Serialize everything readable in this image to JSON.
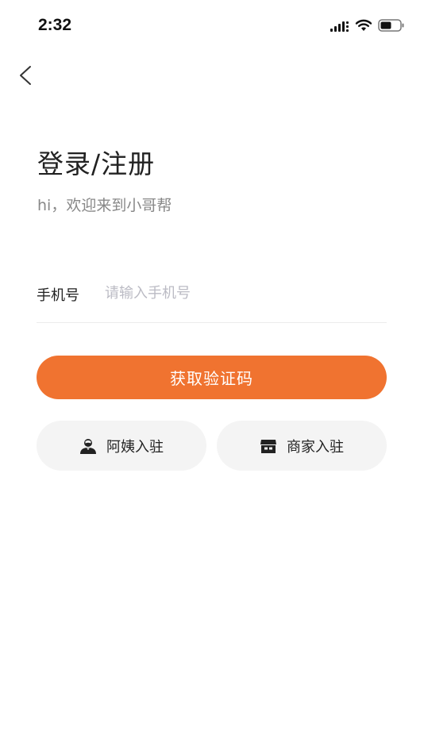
{
  "status_bar": {
    "time": "2:32",
    "icons": [
      "cellular-signal-icon",
      "wifi-icon",
      "battery-icon"
    ]
  },
  "header": {
    "back_icon": "chevron-left-icon"
  },
  "login": {
    "title": "登录/注册",
    "subtitle": "hi，欢迎来到小哥帮",
    "phone_label": "手机号",
    "phone_placeholder": "请输入手机号",
    "phone_value": ""
  },
  "actions": {
    "get_code_label": "获取验证码",
    "auntie_join_label": "阿姨入驻",
    "auntie_join_icon": "person-icon",
    "merchant_join_label": "商家入驻",
    "merchant_join_icon": "store-icon"
  },
  "colors": {
    "accent": "#f07330",
    "secondary_bg": "#f4f4f4",
    "text": "#222222",
    "muted_text": "#888888",
    "placeholder": "#bbbbc4"
  }
}
